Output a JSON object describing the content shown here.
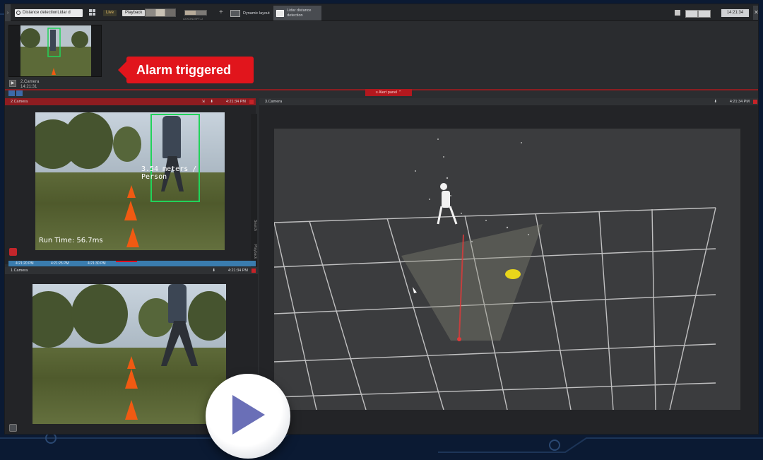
{
  "toolbar": {
    "search_value": "Distance detectionLidar d",
    "live_label": "Live",
    "playback_label": "Playback",
    "layout2_label": "AXXON1SPT-U",
    "tab_dynamic_label": "Dynamic layout",
    "tab_lidar_label": "Lidar distance detection",
    "clock": "14:21:34"
  },
  "alert": {
    "callout": "Alarm triggered",
    "camera_name": "2.Camera",
    "camera_time": "14:21:31",
    "thumb_caption": "Run Time: 56.7ms",
    "panel_tab": "Alert panel"
  },
  "panes": {
    "cam2": {
      "title": "2.Camera",
      "time": "4:21:34 PM",
      "overlay_distance": "3.54 meters / Person",
      "overlay_runtime": "Run Time: 56.7ms"
    },
    "cam1": {
      "title": "1.Camera",
      "time": "4:21:34 PM"
    },
    "cam3": {
      "title": "3.Camera",
      "time": "4:21:34 PM"
    }
  },
  "timeline": {
    "t1": "4:21:20 PM",
    "t2": "4:21:25 PM",
    "t3": "4:21:30 PM"
  },
  "side_rail": {
    "search": "Search",
    "playback": "Playback"
  },
  "colors": {
    "alarm_red": "#e1151c",
    "detect_green": "#21d35a",
    "cone_orange": "#f05a12",
    "timeline_blue": "#3a7cae"
  }
}
